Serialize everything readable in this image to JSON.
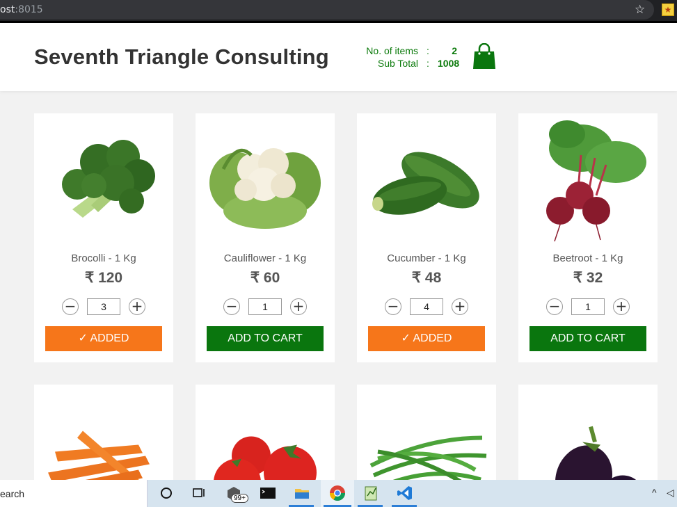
{
  "browser": {
    "url_muted": "ost",
    "url_port": ":8015",
    "bookmark_icon": "star-icon",
    "extension_icon": "extension-icon"
  },
  "header": {
    "brand": "Seventh Triangle Consulting",
    "items_label": "No. of items",
    "items_sep": ":",
    "items_value": "2",
    "subtotal_label": "Sub Total",
    "subtotal_sep": ":",
    "subtotal_value": "1008",
    "cart_icon": "shopping-bag-icon"
  },
  "colors": {
    "green": "#0a760e",
    "orange": "#f6761a",
    "text": "#555555"
  },
  "products": [
    {
      "name": "Brocolli - 1 Kg",
      "price": "₹ 120",
      "qty": "3",
      "button": "✓ ADDED",
      "state": "added"
    },
    {
      "name": "Cauliflower - 1 Kg",
      "price": "₹ 60",
      "qty": "1",
      "button": "ADD TO CART",
      "state": "add"
    },
    {
      "name": "Cucumber - 1 Kg",
      "price": "₹ 48",
      "qty": "4",
      "button": "✓ ADDED",
      "state": "added"
    },
    {
      "name": "Beetroot - 1 Kg",
      "price": "₹ 32",
      "qty": "1",
      "button": "ADD TO CART",
      "state": "add"
    }
  ],
  "qty_controls": {
    "minus": "−",
    "plus": "+"
  },
  "taskbar": {
    "search_text": "earch",
    "badge": "99+",
    "tray_caret": "^"
  }
}
